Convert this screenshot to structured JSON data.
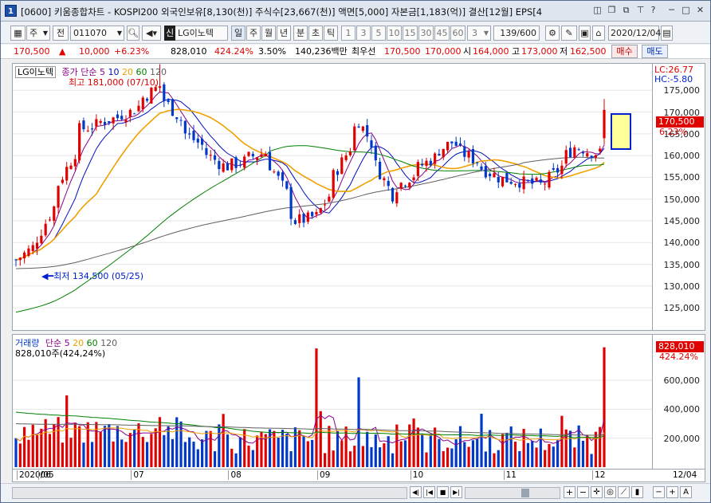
{
  "window": {
    "title": "[0600] 키움종합차트 - KOSPI200 외국인보유[8,130(천)] 주식수[23,667(천)] 액면[5,000] 자본금[1,183(억)] 결산[12월] EPS[4",
    "icon_label": "1"
  },
  "toolbar": {
    "period_unit": "주",
    "prev_label": "전",
    "stock_code": "011070",
    "stock_name": "LG이노텍",
    "credit_badge": "신",
    "period_tabs": [
      "일",
      "주",
      "월",
      "년",
      "분",
      "초",
      "틱"
    ],
    "minute_options": [
      "1",
      "3",
      "5",
      "10",
      "15",
      "30",
      "45",
      "60"
    ],
    "selected_period": "일",
    "interval_value": "3",
    "count_display": "139/600",
    "date": "2020/12/04"
  },
  "quote": {
    "price": "170,500",
    "change_arrow": "▲",
    "change": "10,000",
    "change_pct": "+6.23%",
    "volume": "828,010",
    "volume_ratio": "424.24%",
    "turnover_pct": "3.50%",
    "amount": "140,236백만",
    "best_bid_label": "최우선",
    "best_ask": "170,500",
    "best_bid": "170,000",
    "open_label": "시",
    "open": "164,000",
    "high_label": "고",
    "high": "173,000",
    "low_label": "저",
    "low": "162,500",
    "buy_label": "매수",
    "sell_label": "매도"
  },
  "price_panel": {
    "name_tag": "LG이노텍",
    "legend_label": "종가 단순",
    "ma_periods": [
      "5",
      "10",
      "20",
      "60",
      "120"
    ],
    "high_annotation": "최고 181,000 (07/10)",
    "low_annotation": "최저 134,500 (05/25)",
    "lc_label": "LC:26.77",
    "hc_label": "HC:-5.80",
    "current_tag": "170,500",
    "current_pct_tag": "6.23%",
    "axis_labels": [
      "175,000",
      "170,000",
      "165,000",
      "160,000",
      "155,000",
      "150,000",
      "145,000",
      "140,000",
      "135,000",
      "130,000",
      "125,000"
    ]
  },
  "volume_panel": {
    "legend_label": "거래량",
    "legend_ma": "단순",
    "ma_periods": [
      "5",
      "20",
      "60",
      "120"
    ],
    "value_text": "828,010주(424,24%)",
    "current_tag": "828,010",
    "current_pct_tag": "424.24%",
    "axis_labels": [
      "600,000",
      "400,000",
      "200,000"
    ]
  },
  "date_axis": {
    "labels": [
      "2020/05",
      "06",
      "07",
      "08",
      "09",
      "10",
      "11",
      "12"
    ],
    "end_label": "12/04"
  },
  "colors": {
    "up": "#e00000",
    "down": "#0038c8",
    "ma5": "#8a008a",
    "ma10": "#0010c0",
    "ma20": "#f0a000",
    "ma60": "#008000",
    "ma120": "#606060"
  },
  "chart_data": {
    "type": "candlestick",
    "symbol": "LG이노텍",
    "date_range": [
      "2020/05/25",
      "2020/12/04"
    ],
    "y_range": [
      121000,
      180000
    ],
    "anchor_points": [
      {
        "date": "2020/05/25",
        "close": 136000,
        "low": 134500
      },
      {
        "date": "2020/06/01",
        "close": 141000
      },
      {
        "date": "2020/06/15",
        "close": 166000
      },
      {
        "date": "2020/07/01",
        "close": 170000
      },
      {
        "date": "2020/07/10",
        "close": 176000,
        "high": 181000
      },
      {
        "date": "2020/07/20",
        "close": 165000
      },
      {
        "date": "2020/08/01",
        "close": 157000
      },
      {
        "date": "2020/08/15",
        "close": 161000
      },
      {
        "date": "2020/08/25",
        "close": 145000
      },
      {
        "date": "2020/09/01",
        "close": 146000
      },
      {
        "date": "2020/09/15",
        "close": 168000
      },
      {
        "date": "2020/09/25",
        "close": 151000
      },
      {
        "date": "2020/10/01",
        "close": 155000
      },
      {
        "date": "2020/10/15",
        "close": 163000
      },
      {
        "date": "2020/10/30",
        "close": 155000
      },
      {
        "date": "2020/11/15",
        "close": 153000
      },
      {
        "date": "2020/11/25",
        "close": 162000
      },
      {
        "date": "2020/12/03",
        "close": 160500
      },
      {
        "date": "2020/12/04",
        "open": 164000,
        "high": 173000,
        "low": 162500,
        "close": 170500,
        "volume": 828010
      }
    ],
    "volume_spikes": [
      {
        "date": "2020/09/01",
        "volume": 820000
      },
      {
        "date": "2020/09/15",
        "volume": 620000
      },
      {
        "date": "2020/12/04",
        "volume": 828010
      }
    ],
    "volume_range": [
      0,
      870000
    ]
  }
}
